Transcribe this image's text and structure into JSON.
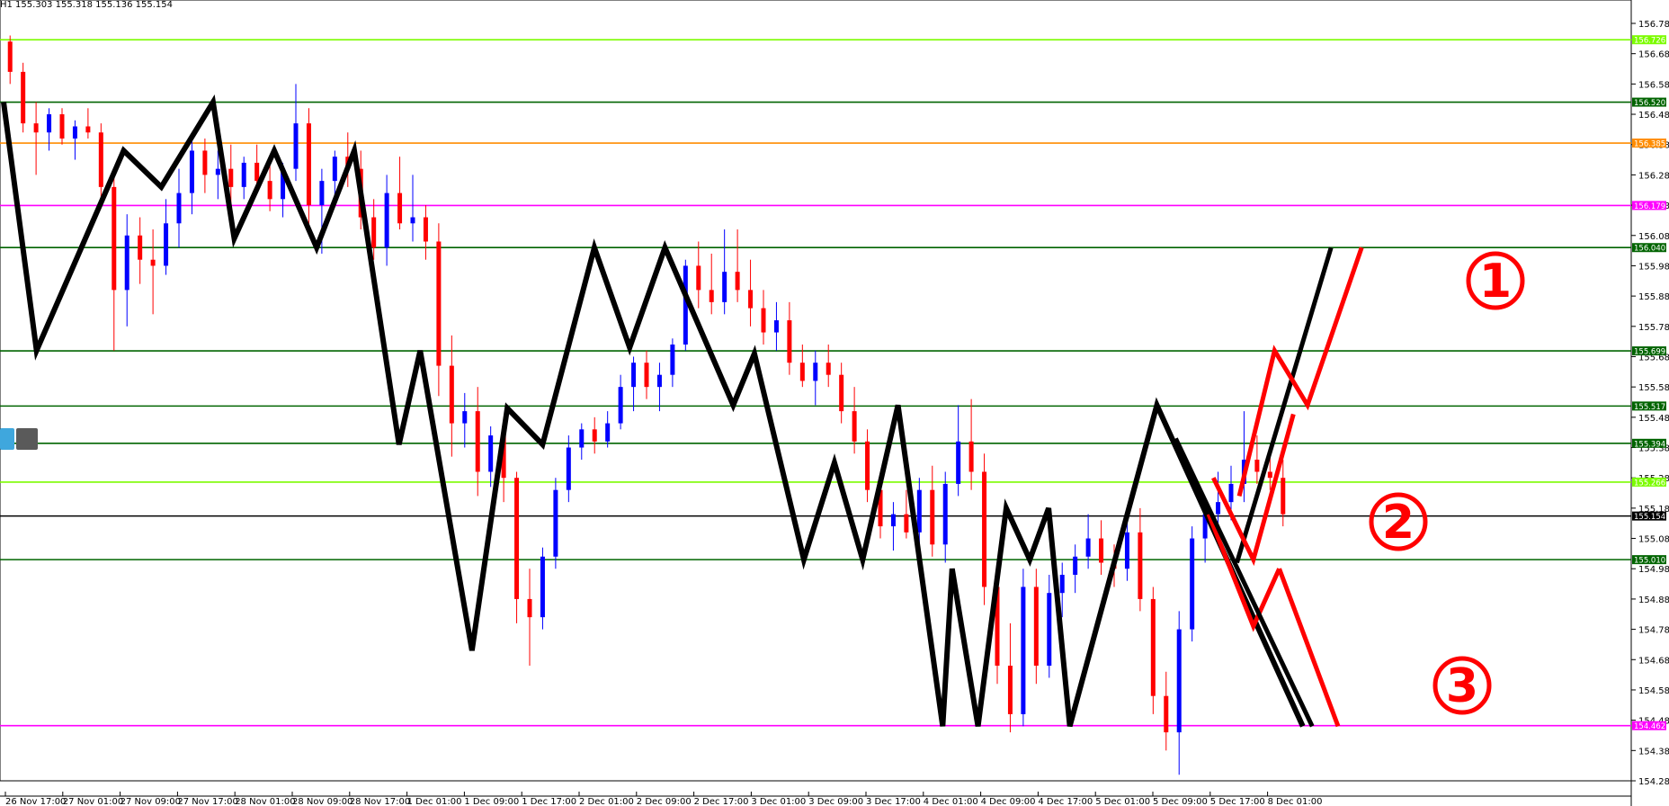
{
  "header": {
    "text": "H1  155.303 155.318 155.136 155.154"
  },
  "colors": {
    "background": "#ffffff",
    "bull_candle": "#0000ff",
    "bear_candle": "#ff0000",
    "wick": "#000000",
    "zigzag": "#000000",
    "projection": "#ff0000",
    "axis_label_text": "#ffffff"
  },
  "chart_data": {
    "type": "candlestick",
    "timeframe": "H1",
    "ylim": [
      154.3,
      156.8
    ],
    "y_ticks": [
      156.78,
      156.68,
      156.58,
      156.48,
      156.38,
      156.28,
      156.18,
      156.08,
      155.98,
      155.88,
      155.78,
      155.68,
      155.58,
      155.48,
      155.38,
      155.28,
      155.18,
      155.08,
      154.98,
      154.88,
      154.78,
      154.68,
      154.58,
      154.48,
      154.38,
      154.28
    ],
    "y_tick_labels": [
      "156.780",
      "156.680",
      "156.580",
      "156.480",
      "156.380",
      "156.280",
      "156.180",
      "156.080",
      "155.980",
      "155.880",
      "155.780",
      "155.680",
      "155.580",
      "155.480",
      "155.380",
      "155.280",
      "155.180",
      "155.080",
      "154.980",
      "154.880",
      "154.780",
      "154.680",
      "154.580",
      "154.480",
      "154.380",
      "154.280"
    ],
    "x_ticks": [
      "26 Nov 17:00",
      "27 Nov 01:00",
      "27 Nov 09:00",
      "27 Nov 17:00",
      "28 Nov 01:00",
      "28 Nov 09:00",
      "28 Nov 17:00",
      "1 Dec 01:00",
      "1 Dec 09:00",
      "1 Dec 17:00",
      "2 Dec 01:00",
      "2 Dec 09:00",
      "2 Dec 17:00",
      "3 Dec 01:00",
      "3 Dec 09:00",
      "3 Dec 17:00",
      "4 Dec 01:00",
      "4 Dec 09:00",
      "4 Dec 17:00",
      "5 Dec 01:00",
      "5 Dec 09:00",
      "5 Dec 17:00",
      "8 Dec 01:00"
    ],
    "horizontal_levels": [
      {
        "price": 156.726,
        "label": "156.726",
        "color": "#7cfc00"
      },
      {
        "price": 156.52,
        "label": "156.520",
        "color": "#006400"
      },
      {
        "price": 156.385,
        "label": "156.385",
        "color": "#ff8c00"
      },
      {
        "price": 156.179,
        "label": "156.179",
        "color": "#ff00ff"
      },
      {
        "price": 156.04,
        "label": "156.040",
        "color": "#006400"
      },
      {
        "price": 155.699,
        "label": "155.699",
        "color": "#006400"
      },
      {
        "price": 155.517,
        "label": "155.517",
        "color": "#006400"
      },
      {
        "price": 155.394,
        "label": "155.394",
        "color": "#006400"
      },
      {
        "price": 155.266,
        "label": "155.266",
        "color": "#7cfc00"
      },
      {
        "price": 155.154,
        "label": "155.154",
        "color": "#000000"
      },
      {
        "price": 155.01,
        "label": "155.010",
        "color": "#006400"
      },
      {
        "price": 154.462,
        "label": "154.462",
        "color": "#ff00ff"
      }
    ],
    "candles": [
      [
        156.72,
        156.74,
        156.58,
        156.62
      ],
      [
        156.62,
        156.65,
        156.42,
        156.45
      ],
      [
        156.45,
        156.52,
        156.28,
        156.42
      ],
      [
        156.42,
        156.5,
        156.36,
        156.48
      ],
      [
        156.48,
        156.5,
        156.38,
        156.4
      ],
      [
        156.4,
        156.46,
        156.33,
        156.44
      ],
      [
        156.44,
        156.5,
        156.4,
        156.42
      ],
      [
        156.42,
        156.45,
        156.2,
        156.24
      ],
      [
        156.24,
        156.28,
        155.7,
        155.9
      ],
      [
        155.9,
        156.15,
        155.78,
        156.08
      ],
      [
        156.08,
        156.14,
        155.92,
        156.0
      ],
      [
        156.0,
        156.1,
        155.82,
        155.98
      ],
      [
        155.98,
        156.2,
        155.95,
        156.12
      ],
      [
        156.12,
        156.3,
        156.04,
        156.22
      ],
      [
        156.22,
        156.4,
        156.15,
        156.36
      ],
      [
        156.36,
        156.4,
        156.22,
        156.28
      ],
      [
        156.28,
        156.36,
        156.2,
        156.3
      ],
      [
        156.3,
        156.38,
        156.18,
        156.24
      ],
      [
        156.24,
        156.34,
        156.2,
        156.32
      ],
      [
        156.32,
        156.38,
        156.24,
        156.26
      ],
      [
        156.26,
        156.34,
        156.16,
        156.2
      ],
      [
        156.2,
        156.32,
        156.14,
        156.3
      ],
      [
        156.3,
        156.58,
        156.26,
        156.45
      ],
      [
        156.45,
        156.5,
        156.1,
        156.18
      ],
      [
        156.18,
        156.3,
        156.02,
        156.26
      ],
      [
        156.26,
        156.36,
        156.2,
        156.34
      ],
      [
        156.34,
        156.42,
        156.24,
        156.3
      ],
      [
        156.3,
        156.36,
        156.1,
        156.14
      ],
      [
        156.14,
        156.2,
        156.0,
        156.04
      ],
      [
        156.04,
        156.28,
        155.98,
        156.22
      ],
      [
        156.22,
        156.34,
        156.1,
        156.12
      ],
      [
        156.12,
        156.28,
        156.06,
        156.14
      ],
      [
        156.14,
        156.18,
        156.0,
        156.06
      ],
      [
        156.06,
        156.12,
        155.55,
        155.65
      ],
      [
        155.65,
        155.75,
        155.35,
        155.46
      ],
      [
        155.46,
        155.56,
        155.38,
        155.5
      ],
      [
        155.5,
        155.58,
        155.22,
        155.3
      ],
      [
        155.3,
        155.45,
        155.25,
        155.42
      ],
      [
        155.42,
        155.48,
        155.2,
        155.28
      ],
      [
        155.28,
        155.3,
        154.8,
        154.88
      ],
      [
        154.88,
        154.98,
        154.66,
        154.82
      ],
      [
        154.82,
        155.05,
        154.78,
        155.02
      ],
      [
        155.02,
        155.28,
        154.98,
        155.24
      ],
      [
        155.24,
        155.42,
        155.2,
        155.38
      ],
      [
        155.38,
        155.46,
        155.34,
        155.44
      ],
      [
        155.44,
        155.48,
        155.36,
        155.4
      ],
      [
        155.4,
        155.5,
        155.38,
        155.46
      ],
      [
        155.46,
        155.62,
        155.44,
        155.58
      ],
      [
        155.58,
        155.68,
        155.5,
        155.66
      ],
      [
        155.66,
        155.7,
        155.54,
        155.58
      ],
      [
        155.58,
        155.66,
        155.5,
        155.62
      ],
      [
        155.62,
        155.74,
        155.58,
        155.72
      ],
      [
        155.72,
        156.0,
        155.7,
        155.98
      ],
      [
        155.98,
        156.06,
        155.84,
        155.9
      ],
      [
        155.9,
        156.02,
        155.82,
        155.86
      ],
      [
        155.86,
        156.1,
        155.82,
        155.96
      ],
      [
        155.96,
        156.1,
        155.86,
        155.9
      ],
      [
        155.9,
        156.0,
        155.78,
        155.84
      ],
      [
        155.84,
        155.9,
        155.72,
        155.76
      ],
      [
        155.76,
        155.86,
        155.7,
        155.8
      ],
      [
        155.8,
        155.86,
        155.62,
        155.66
      ],
      [
        155.66,
        155.72,
        155.58,
        155.6
      ],
      [
        155.6,
        155.7,
        155.52,
        155.66
      ],
      [
        155.66,
        155.72,
        155.58,
        155.62
      ],
      [
        155.62,
        155.66,
        155.46,
        155.5
      ],
      [
        155.5,
        155.58,
        155.36,
        155.4
      ],
      [
        155.4,
        155.44,
        155.2,
        155.24
      ],
      [
        155.24,
        155.3,
        155.08,
        155.12
      ],
      [
        155.12,
        155.2,
        155.04,
        155.16
      ],
      [
        155.16,
        155.24,
        155.08,
        155.1
      ],
      [
        155.1,
        155.28,
        155.06,
        155.24
      ],
      [
        155.24,
        155.32,
        155.02,
        155.06
      ],
      [
        155.06,
        155.3,
        155.0,
        155.26
      ],
      [
        155.26,
        155.52,
        155.22,
        155.4
      ],
      [
        155.4,
        155.54,
        155.24,
        155.3
      ],
      [
        155.3,
        155.36,
        154.86,
        154.92
      ],
      [
        154.92,
        155.0,
        154.6,
        154.66
      ],
      [
        154.66,
        154.8,
        154.44,
        154.5
      ],
      [
        154.5,
        154.98,
        154.46,
        154.92
      ],
      [
        154.92,
        154.98,
        154.6,
        154.66
      ],
      [
        154.66,
        154.96,
        154.62,
        154.9
      ],
      [
        154.9,
        155.0,
        154.82,
        154.96
      ],
      [
        154.96,
        155.06,
        154.9,
        155.02
      ],
      [
        155.02,
        155.16,
        154.98,
        155.08
      ],
      [
        155.08,
        155.14,
        154.96,
        155.0
      ],
      [
        155.0,
        155.06,
        154.92,
        154.98
      ],
      [
        154.98,
        155.16,
        154.94,
        155.1
      ],
      [
        155.1,
        155.18,
        154.84,
        154.88
      ],
      [
        154.88,
        154.92,
        154.5,
        154.56
      ],
      [
        154.56,
        154.64,
        154.38,
        154.44
      ],
      [
        154.44,
        154.84,
        154.3,
        154.78
      ],
      [
        154.78,
        155.12,
        154.74,
        155.08
      ],
      [
        155.08,
        155.2,
        155.0,
        155.16
      ],
      [
        155.16,
        155.3,
        155.1,
        155.2
      ],
      [
        155.2,
        155.32,
        155.14,
        155.26
      ],
      [
        155.26,
        155.5,
        155.2,
        155.34
      ],
      [
        155.34,
        155.42,
        155.26,
        155.3
      ],
      [
        155.3,
        155.38,
        155.24,
        155.28
      ],
      [
        155.28,
        155.34,
        155.12,
        155.16
      ]
    ],
    "zigzag": [
      [
        0,
        156.52
      ],
      [
        1.4,
        155.7
      ],
      [
        5.1,
        156.36
      ],
      [
        6.7,
        156.24
      ],
      [
        8.9,
        156.52
      ],
      [
        9.8,
        156.07
      ],
      [
        11.5,
        156.36
      ],
      [
        13.3,
        156.04
      ],
      [
        14.9,
        156.36
      ],
      [
        16.8,
        155.39
      ],
      [
        17.7,
        155.7
      ],
      [
        19.9,
        154.71
      ],
      [
        21.4,
        155.51
      ],
      [
        22.9,
        155.39
      ],
      [
        25.1,
        156.04
      ],
      [
        26.6,
        155.71
      ],
      [
        28.1,
        156.04
      ],
      [
        31.0,
        155.52
      ],
      [
        31.9,
        155.69
      ],
      [
        34.0,
        155.01
      ],
      [
        35.3,
        155.33
      ],
      [
        36.5,
        155.01
      ],
      [
        38.0,
        155.52
      ],
      [
        39.9,
        154.46
      ],
      [
        40.3,
        154.98
      ],
      [
        41.4,
        154.46
      ],
      [
        42.6,
        155.18
      ],
      [
        43.6,
        155.01
      ],
      [
        44.4,
        155.18
      ],
      [
        45.3,
        154.46
      ],
      [
        49.0,
        155.52
      ],
      [
        55.2,
        154.46
      ]
    ],
    "projections": [
      {
        "label": "①",
        "color": "#000000",
        "points": [
          [
            52.4,
            155.0
          ],
          [
            56.4,
            156.04
          ]
        ]
      },
      {
        "label": "①",
        "color": "#ff0000",
        "points": [
          [
            52.5,
            155.22
          ],
          [
            54.0,
            155.7
          ],
          [
            55.4,
            155.52
          ],
          [
            57.7,
            156.04
          ]
        ]
      },
      {
        "label": "②",
        "color": "#ff0000",
        "points": [
          [
            51.4,
            155.28
          ],
          [
            53.1,
            155.01
          ],
          [
            54.8,
            155.49
          ]
        ]
      },
      {
        "label": "②",
        "color": "#ff0000",
        "points": [
          [
            51.2,
            155.16
          ],
          [
            53.1,
            154.79
          ],
          [
            54.2,
            154.98
          ]
        ]
      },
      {
        "label": "③",
        "color": "#ff0000",
        "points": [
          [
            54.2,
            154.98
          ],
          [
            56.7,
            154.46
          ]
        ]
      },
      {
        "label": "③",
        "color": "#000000",
        "points": [
          [
            49.8,
            155.41
          ],
          [
            55.6,
            154.46
          ]
        ]
      }
    ],
    "circle_labels": [
      "①",
      "②",
      "③"
    ]
  }
}
